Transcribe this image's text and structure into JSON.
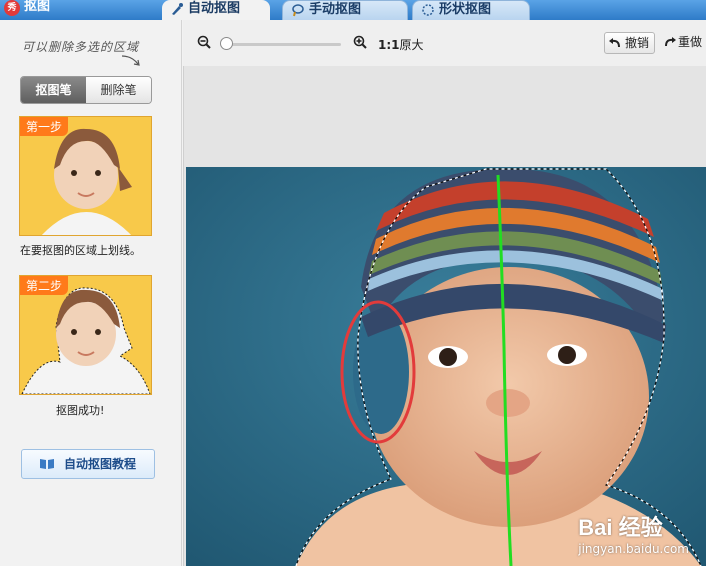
{
  "app": {
    "title": "抠图",
    "logo_text": "秀"
  },
  "tabs": [
    {
      "label": "自动抠图",
      "active": true,
      "icon": "brush-icon"
    },
    {
      "label": "手动抠图",
      "active": false,
      "icon": "lasso-icon"
    },
    {
      "label": "形状抠图",
      "active": false,
      "icon": "shape-icon"
    }
  ],
  "sidebar": {
    "hint": "可以删除多选的区域",
    "toggle": {
      "pen": "抠图笔",
      "eraser": "删除笔"
    },
    "steps": [
      {
        "badge": "第一步",
        "caption": "在要抠图的区域上划线。"
      },
      {
        "badge": "第二步",
        "caption": "抠图成功!"
      }
    ],
    "tutorial_label": "自动抠图教程"
  },
  "toolbar": {
    "ratio_bold": "1:1",
    "ratio_text": "原大",
    "undo_label": "撤销",
    "redo_label": "重做",
    "zoom_percent": 0
  },
  "watermark": {
    "brand": "Bai 经验",
    "url": "jingyan.baidu.com"
  },
  "colors": {
    "accent": "#2e7bc8",
    "photo_bg": "#2b6781",
    "stroke_green": "#22dd22",
    "annotation_red": "#e23b3b"
  }
}
